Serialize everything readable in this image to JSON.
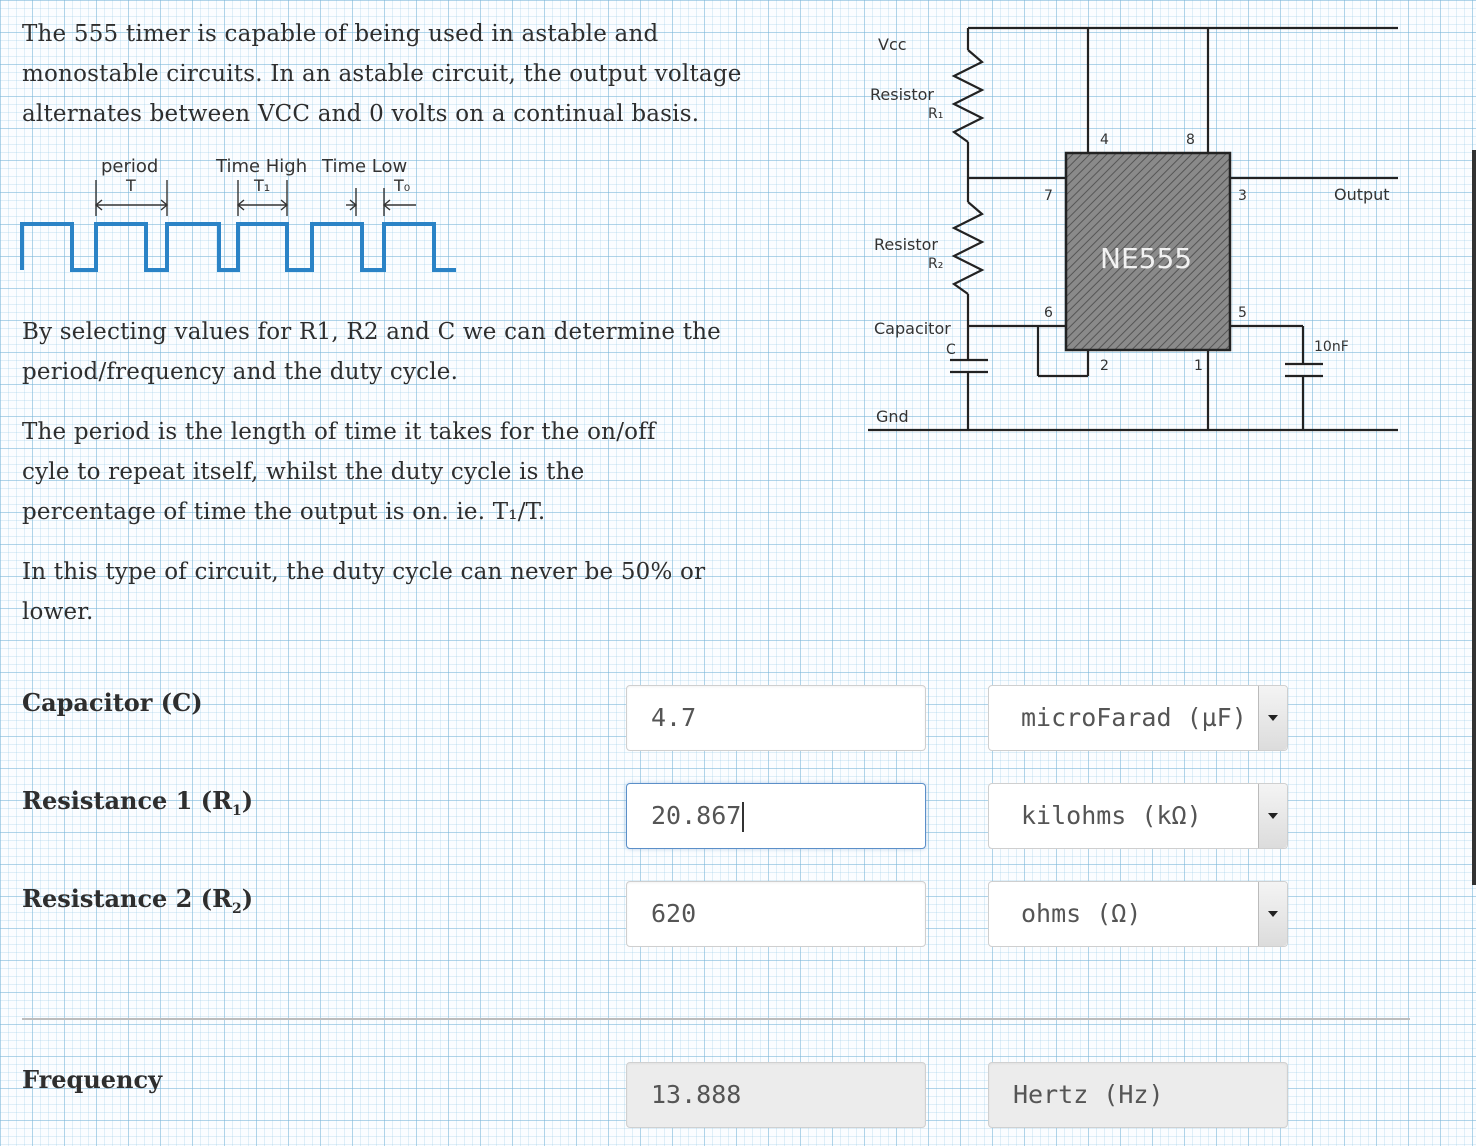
{
  "intro": {
    "lines": [
      "The 555 timer is capable of being used in astable and",
      "monostable circuits. In an astable circuit, the output voltage",
      "alternates between VCC and 0 volts on a continual basis."
    ],
    "selection": [
      "By selecting values for R1, R2 and C we can determine the",
      "period/frequency and the duty cycle."
    ],
    "period": [
      "The period is the length of time it takes for the on/off",
      "cyle to repeat itself, whilst the duty cycle is the",
      "percentage of time the output is on. ie. T₁/T."
    ],
    "duty": [
      "In this type of circuit, the duty cycle can never be 50% or",
      "lower."
    ]
  },
  "waveform": {
    "period_label": "period",
    "period_symbol": "T",
    "time_high_label": "Time High",
    "time_high_symbol": "T₁",
    "time_low_label": "Time Low",
    "time_low_symbol": "T₀"
  },
  "circuit": {
    "vcc": "Vcc",
    "resistor1_label": "Resistor",
    "resistor1_symbol": "R₁",
    "resistor2_label": "Resistor",
    "resistor2_symbol": "R₂",
    "capacitor_label": "Capacitor",
    "capacitor_symbol": "C",
    "gnd": "Gnd",
    "chip": "NE555",
    "pin4": "4",
    "pin8": "8",
    "pin7": "7",
    "pin3": "3",
    "pin6": "6",
    "pin5": "5",
    "pin2": "2",
    "pin1": "1",
    "output": "Output",
    "cap_value": "10nF"
  },
  "form": {
    "capacitor": {
      "label": "Capacitor (C)",
      "value": "4.7",
      "unit": "microFarad (µF)"
    },
    "resistance1": {
      "label_prefix": "Resistance 1 (R",
      "label_sub": "1",
      "label_suffix": ")",
      "value": "20.867",
      "unit": "kilohms (kΩ)"
    },
    "resistance2": {
      "label_prefix": "Resistance 2 (R",
      "label_sub": "2",
      "label_suffix": ")",
      "value": "620",
      "unit": "ohms (Ω)"
    },
    "frequency": {
      "label": "Frequency",
      "value": "13.888",
      "unit": "Hertz (Hz)"
    }
  }
}
